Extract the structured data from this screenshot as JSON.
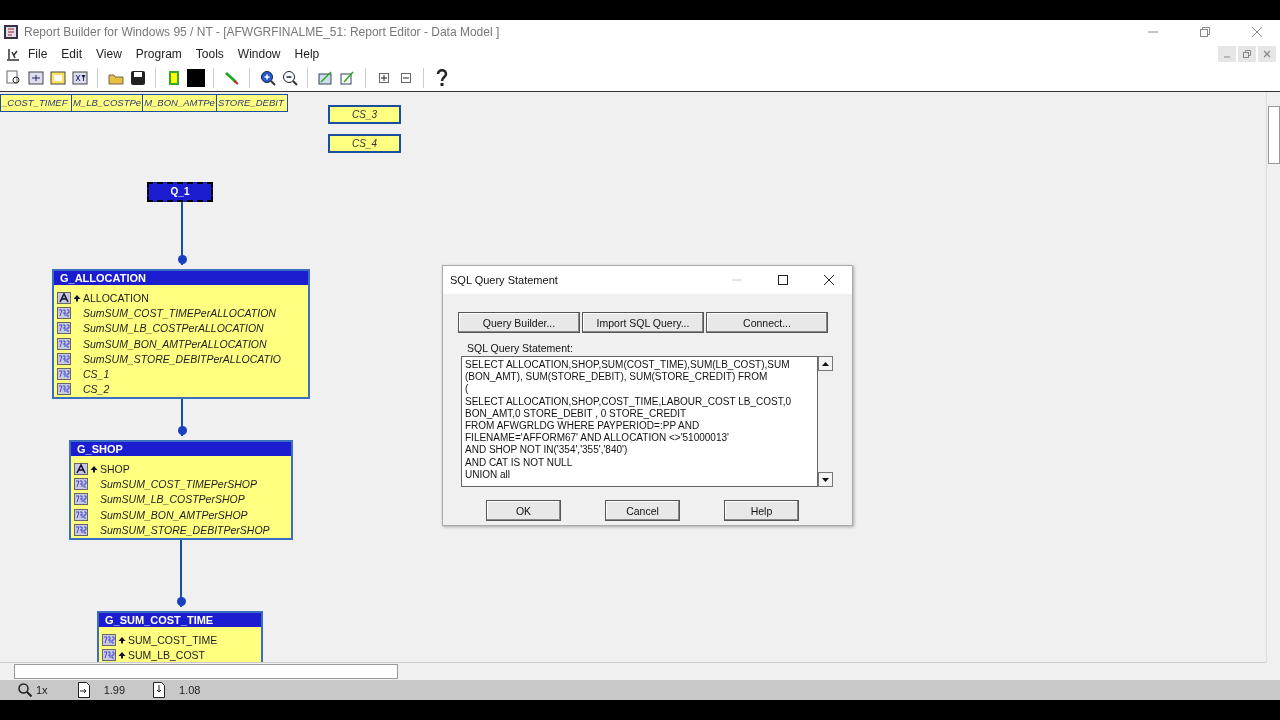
{
  "window": {
    "title": "Report Builder for Windows 95 / NT - [AFWGRFINALME_51: Report Editor - Data Model ]"
  },
  "menu": [
    "File",
    "Edit",
    "View",
    "Program",
    "Tools",
    "Window",
    "Help"
  ],
  "canvas": {
    "header_columns": [
      "_COST_TIMEF",
      "M_LB_COSTPe",
      "M_BON_AMTPe",
      "STORE_DEBIT"
    ],
    "formula_columns": [
      "CS_3",
      "CS_4"
    ],
    "query": {
      "name": "Q_1",
      "selected": true
    },
    "groups": [
      {
        "name": "G_ALLOCATION",
        "items": [
          {
            "label": "ALLOCATION",
            "kind": "text",
            "break": true
          },
          {
            "label": "SumSUM_COST_TIMEPerALLOCATION",
            "kind": "number",
            "break": false
          },
          {
            "label": "SumSUM_LB_COSTPerALLOCATION",
            "kind": "number",
            "break": false
          },
          {
            "label": "SumSUM_BON_AMTPerALLOCATION",
            "kind": "number",
            "break": false
          },
          {
            "label": "SumSUM_STORE_DEBITPerALLOCATIO",
            "kind": "number",
            "break": false
          },
          {
            "label": "CS_1",
            "kind": "number",
            "break": false
          },
          {
            "label": "CS_2",
            "kind": "number",
            "break": false
          }
        ]
      },
      {
        "name": "G_SHOP",
        "items": [
          {
            "label": "SHOP",
            "kind": "text",
            "break": true
          },
          {
            "label": "SumSUM_COST_TIMEPerSHOP",
            "kind": "number",
            "break": false
          },
          {
            "label": "SumSUM_LB_COSTPerSHOP",
            "kind": "number",
            "break": false
          },
          {
            "label": "SumSUM_BON_AMTPerSHOP",
            "kind": "number",
            "break": false
          },
          {
            "label": "SumSUM_STORE_DEBITPerSHOP",
            "kind": "number",
            "break": false
          }
        ]
      },
      {
        "name": "G_SUM_COST_TIME",
        "items": [
          {
            "label": "SUM_COST_TIME",
            "kind": "number",
            "break": true
          },
          {
            "label": "SUM_LB_COST",
            "kind": "number",
            "break": true
          }
        ]
      }
    ]
  },
  "dialog": {
    "title": "SQL Query Statement",
    "top_buttons": [
      "Query Builder...",
      "Import SQL Query...",
      "Connect..."
    ],
    "field_label": "SQL Query Statement:",
    "sql_lines": [
      "SELECT ALLOCATION,SHOP,SUM(COST_TIME),SUM(LB_COST),SUM",
      "(BON_AMT), SUM(STORE_DEBIT), SUM(STORE_CREDIT) FROM",
      "(",
      "SELECT ALLOCATION,SHOP,COST_TIME,LABOUR_COST LB_COST,0",
      "BON_AMT,0 STORE_DEBIT , 0 STORE_CREDIT",
      "FROM AFWGRLDG WHERE PAYPERIOD=:PP AND",
      "FILENAME='AFFORM67' AND ALLOCATION <>'51000013'",
      "AND SHOP NOT IN('354','355','840')",
      "AND CAT IS NOT NULL",
      "UNION all"
    ],
    "bottom_buttons": [
      "OK",
      "Cancel",
      "Help"
    ]
  },
  "status_bar": {
    "zoom": "1x",
    "value_1": "1.99",
    "value_2": "1.08"
  }
}
